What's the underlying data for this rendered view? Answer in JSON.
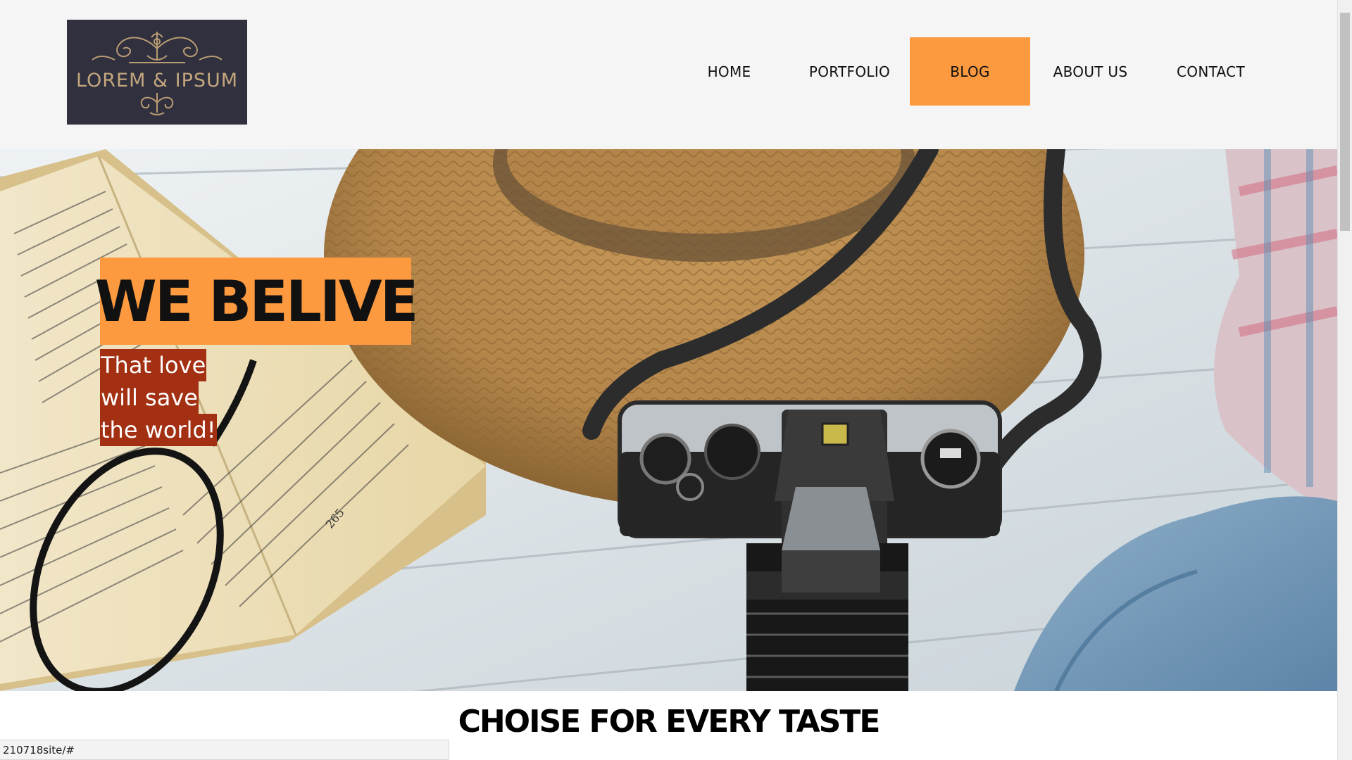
{
  "logo": {
    "text": "LOREM & IPSUM"
  },
  "nav": {
    "items": [
      {
        "label": "HOME"
      },
      {
        "label": "PORTFOLIO"
      },
      {
        "label": "BLOG"
      },
      {
        "label": "ABOUT US"
      },
      {
        "label": "CONTACT"
      }
    ],
    "active": "BLOG"
  },
  "hero": {
    "title": "WE BELIVE",
    "subtitle_lines": [
      "That love",
      "will save",
      "the world!"
    ],
    "image_content": "book-glasses-straw-hat-camera-flatlay",
    "book_page_number": "265"
  },
  "section": {
    "title": "CHOISE FOR EVERY TASTE"
  },
  "status_bar": {
    "url": "210718site/#"
  },
  "colors": {
    "header_bg": "#f5f5f5",
    "accent_orange": "#fd9a40",
    "subtitle_highlight": "#a33012",
    "logo_bg": "#30303f",
    "logo_gold": "#c3a67c"
  }
}
